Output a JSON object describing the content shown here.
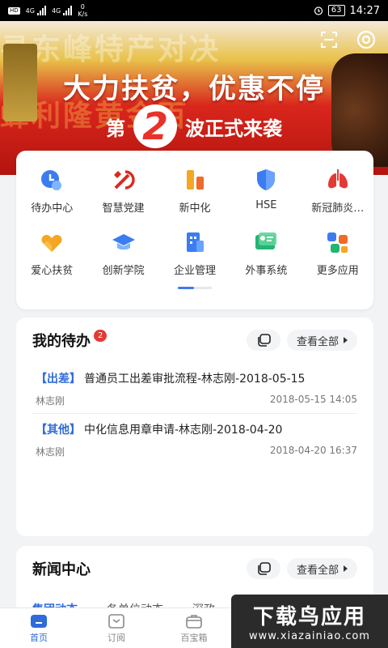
{
  "status_bar": {
    "net_speed_value": "0",
    "net_speed_unit": "K/s",
    "signal_1": "4G",
    "signal_2": "4G",
    "battery": "63",
    "time": "14:27"
  },
  "banner": {
    "ghost_text_1": "寻东峰特产对决",
    "ghost_text_2": "蜂利隆黄金百",
    "headline": "大力扶贫，优惠不停",
    "sub_prefix": "第",
    "sub_number": "2",
    "sub_suffix": "波正式来袭"
  },
  "apps": [
    {
      "label": "待办中心",
      "icon": "clock-icon"
    },
    {
      "label": "智慧党建",
      "icon": "party-emblem-icon"
    },
    {
      "label": "新中化",
      "icon": "building-bars-icon"
    },
    {
      "label": "HSE",
      "icon": "shield-icon"
    },
    {
      "label": "新冠肺炎…",
      "icon": "lungs-icon"
    },
    {
      "label": "爱心扶贫",
      "icon": "heart-hands-icon"
    },
    {
      "label": "创新学院",
      "icon": "graduation-cap-icon"
    },
    {
      "label": "企业管理",
      "icon": "office-building-icon"
    },
    {
      "label": "外事系统",
      "icon": "id-card-icon"
    },
    {
      "label": "更多应用",
      "icon": "more-apps-icon"
    }
  ],
  "todo": {
    "title": "我的待办",
    "count": "2",
    "view_all": "查看全部",
    "items": [
      {
        "tag": "【出差】",
        "title": "普通员工出差审批流程-林志刚-2018-05-15",
        "person": "林志刚",
        "time": "2018-05-15 14:05"
      },
      {
        "tag": "【其他】",
        "title": "中化信息用章申请-林志刚-2018-04-20",
        "person": "林志刚",
        "time": "2018-04-20 16:37"
      }
    ]
  },
  "news": {
    "title": "新闻中心",
    "view_all": "查看全部",
    "tabs": [
      "集团动态",
      "各单位动态",
      "深政"
    ]
  },
  "bottom_nav": [
    {
      "label": "首页",
      "icon": "home-icon",
      "active": true
    },
    {
      "label": "订阅",
      "icon": "subscribe-icon",
      "active": false
    },
    {
      "label": "百宝箱",
      "icon": "toolbox-icon",
      "active": false
    }
  ],
  "watermark": {
    "title": "下载鸟应用",
    "url": "www.xiazainiao.com"
  },
  "colors": {
    "accent": "#2f6bd9",
    "badge": "#e53935",
    "banner_red": "#d9261c"
  }
}
